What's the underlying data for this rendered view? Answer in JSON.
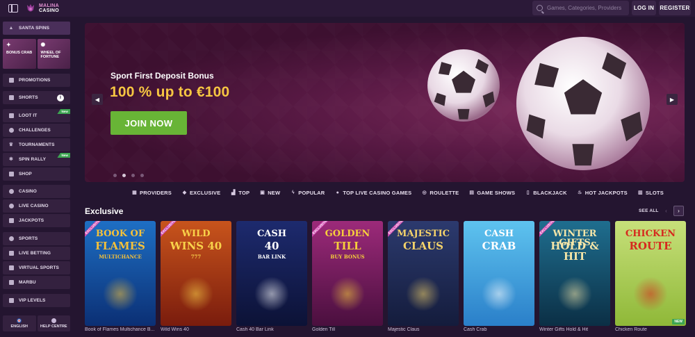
{
  "header": {
    "logo_line1": "MALINA",
    "logo_line2": "CASINO",
    "search_placeholder": "Games, Categories, Providers",
    "login_label": "LOG IN",
    "register_label": "REGISTER"
  },
  "sidebar": {
    "santa_spins": "SANTA SPINS",
    "bonus_crab": "BONUS CRAB",
    "wheel_of_fortune": "WHEEL OF FORTUNE",
    "promotions": "PROMOTIONS",
    "shorts": "SHORTS",
    "loot_it": "LOOT IT",
    "challenges": "CHALLENGES",
    "tournaments": "TOURNAMENTS",
    "spin_rally": "SPIN RALLY",
    "shop": "SHOP",
    "casino": "CASINO",
    "live_casino": "LIVE CASINO",
    "jackpots": "JACKPOTS",
    "sports": "SPORTS",
    "live_betting": "LIVE BETTING",
    "virtual_sports": "VIRTUAL SPORTS",
    "marbu": "MARBU",
    "vip_levels": "VIP LEVELS",
    "new_badge": "New",
    "language": "ENGLISH",
    "help_centre": "HELP CENTRE"
  },
  "hero": {
    "subtitle": "Sport First Deposit Bonus",
    "title": "100 % up to €100",
    "cta": "JOIN NOW",
    "slide_count": 4,
    "active_slide": 2
  },
  "categories": [
    {
      "label": "PROVIDERS",
      "icon": "grid-icon"
    },
    {
      "label": "EXCLUSIVE",
      "icon": "diamond-icon"
    },
    {
      "label": "TOP",
      "icon": "podium-icon"
    },
    {
      "label": "NEW",
      "icon": "new-icon"
    },
    {
      "label": "POPULAR",
      "icon": "bolt-icon"
    },
    {
      "label": "TOP LIVE CASINO GAMES",
      "icon": "live-icon"
    },
    {
      "label": "ROULETTE",
      "icon": "roulette-icon"
    },
    {
      "label": "GAME SHOWS",
      "icon": "gameshow-icon"
    },
    {
      "label": "BLACKJACK",
      "icon": "cards-icon"
    },
    {
      "label": "HOT JACKPOTS",
      "icon": "flame-icon"
    },
    {
      "label": "SLOTS",
      "icon": "slots-icon"
    }
  ],
  "exclusive": {
    "title": "Exclusive",
    "see_all": "SEE ALL",
    "exclusive_badge": "EXCLUSIVE",
    "new_badge": "NEW",
    "games": [
      {
        "name": "Book of Flames Multichance B...",
        "art_l1": "BOOK OF",
        "art_l2": "FLAMES",
        "art_l3": "MULTICHANCE",
        "bg1": "#1e6fc4",
        "bg2": "#0b2f74",
        "text": "#f5c13a",
        "exclusive": true,
        "is_new": false
      },
      {
        "name": "Wild Wins 40",
        "art_l1": "WILD",
        "art_l2": "WINS 40",
        "art_l3": "777",
        "bg1": "#c8541c",
        "bg2": "#7a1c0d",
        "text": "#f9d34a",
        "exclusive": true,
        "is_new": false
      },
      {
        "name": "Cash 40 Bar Link",
        "art_l1": "CASH",
        "art_l2": "40",
        "art_l3": "BAR LINK",
        "bg1": "#1d2a6e",
        "bg2": "#0c1236",
        "text": "#ffffff",
        "exclusive": false,
        "is_new": false
      },
      {
        "name": "Golden Till",
        "art_l1": "GOLDEN",
        "art_l2": "TILL",
        "art_l3": "BUY BONUS",
        "bg1": "#9c2a7a",
        "bg2": "#4a0f3e",
        "text": "#f7cf3b",
        "exclusive": true,
        "is_new": false
      },
      {
        "name": "Majestic Claus",
        "art_l1": "MAJESTIC",
        "art_l2": "CLAUS",
        "art_l3": "",
        "bg1": "#2c3a6e",
        "bg2": "#141c3c",
        "text": "#f4d36a",
        "exclusive": true,
        "is_new": false
      },
      {
        "name": "Cash Crab",
        "art_l1": "CASH",
        "art_l2": "CRAB",
        "art_l3": "",
        "bg1": "#5ec3ef",
        "bg2": "#2a7fc9",
        "text": "#ffffff",
        "exclusive": false,
        "is_new": false
      },
      {
        "name": "Winter Gifts Hold & Hit",
        "art_l1": "WINTER GIFTS",
        "art_l2": "HOLD & HIT",
        "art_l3": "",
        "bg1": "#1f6e8f",
        "bg2": "#0b2f45",
        "text": "#f5e6a8",
        "exclusive": true,
        "is_new": false
      },
      {
        "name": "Chicken Route",
        "art_l1": "CHICKEN",
        "art_l2": "ROUTE",
        "art_l3": "",
        "bg1": "#c7e07a",
        "bg2": "#8fb838",
        "text": "#d6281e",
        "exclusive": false,
        "is_new": true
      }
    ]
  },
  "colors": {
    "background": "#241530",
    "accent_gold": "#f6c642",
    "cta_green": "#68b436",
    "new_green": "#3da552",
    "exclusive_pink": "#d04ab0"
  }
}
